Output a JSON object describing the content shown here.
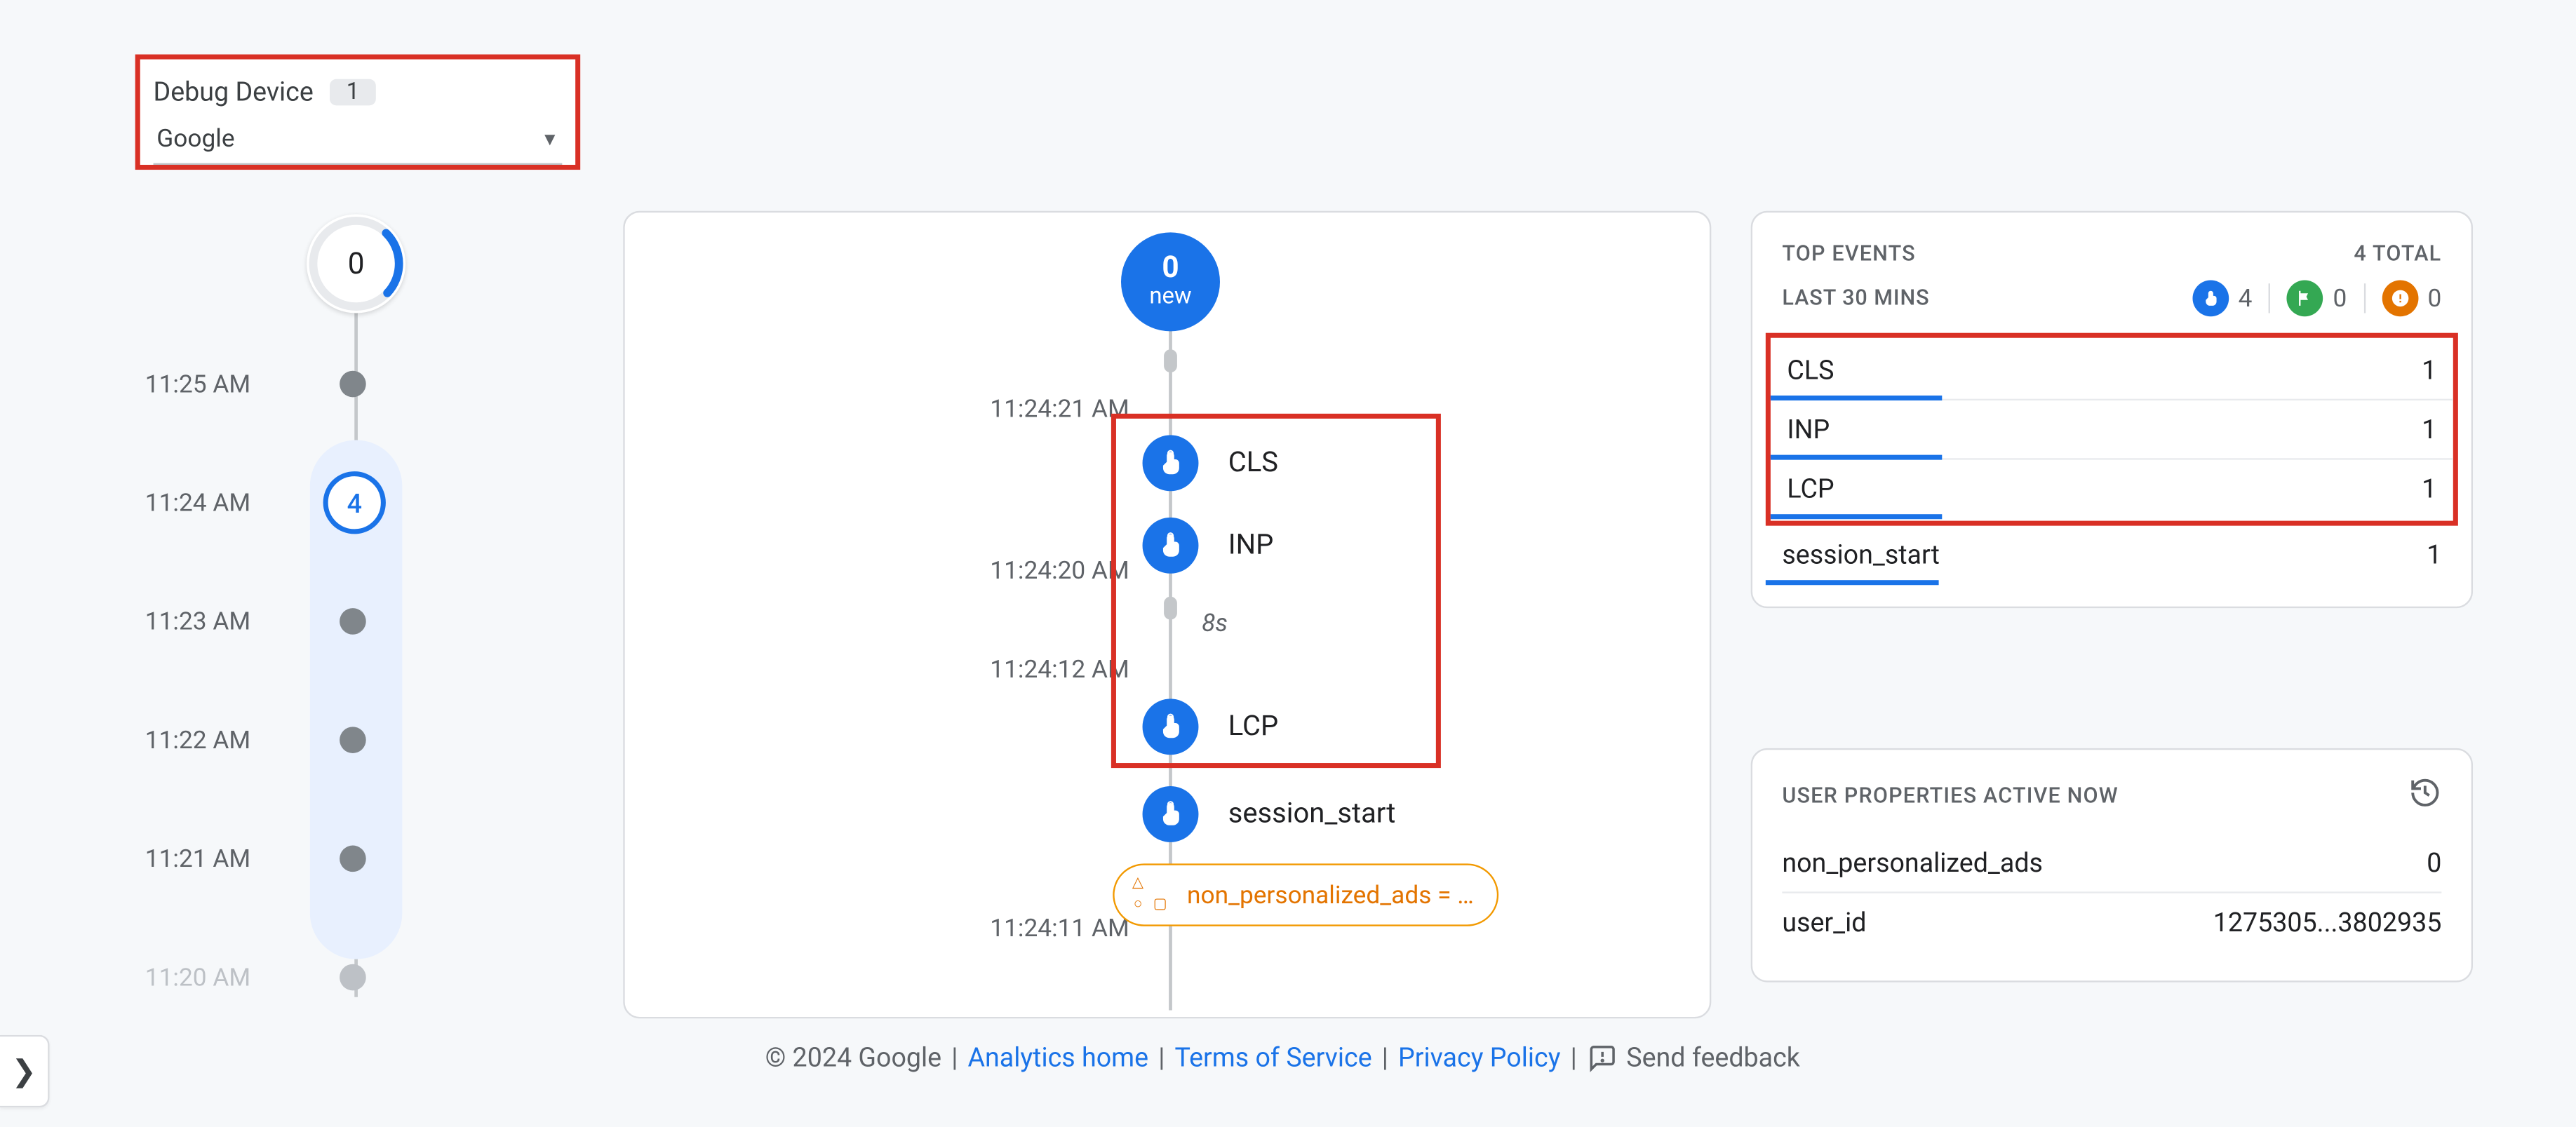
{
  "debugDevice": {
    "label": "Debug Device",
    "count": "1",
    "selected": "Google"
  },
  "minuteTimeline": {
    "spinnerValue": "0",
    "markers": [
      {
        "time": "11:25 AM",
        "type": "dot"
      },
      {
        "time": "11:24 AM",
        "type": "count",
        "count": "4"
      },
      {
        "time": "11:23 AM",
        "type": "dot"
      },
      {
        "time": "11:22 AM",
        "type": "dot"
      },
      {
        "time": "11:21 AM",
        "type": "dot"
      },
      {
        "time": "11:20 AM",
        "type": "dot",
        "faded": true
      }
    ]
  },
  "eventStream": {
    "newBubble": {
      "count": "0",
      "label": "new"
    },
    "timestamps": {
      "t1": "11:24:21 AM",
      "t2": "11:24:20 AM",
      "t3": "11:24:12 AM",
      "t4": "11:24:11 AM"
    },
    "elapsed": "8s",
    "events": {
      "cls": "CLS",
      "inp": "INP",
      "lcp": "LCP",
      "session_start": "session_start"
    },
    "propertyPill": "non_personalized_ads = …"
  },
  "topEvents": {
    "title": "TOP EVENTS",
    "totalLabel": "4 TOTAL",
    "subLabel": "LAST 30 MINS",
    "iconCounts": {
      "touch": "4",
      "flag": "0",
      "error": "0"
    },
    "rows": [
      {
        "name": "CLS",
        "count": "1",
        "barPct": 25
      },
      {
        "name": "INP",
        "count": "1",
        "barPct": 25
      },
      {
        "name": "LCP",
        "count": "1",
        "barPct": 25
      },
      {
        "name": "session_start",
        "count": "1",
        "barPct": 25
      }
    ]
  },
  "userProps": {
    "title": "USER PROPERTIES ACTIVE NOW",
    "rows": [
      {
        "name": "non_personalized_ads",
        "value": "0"
      },
      {
        "name": "user_id",
        "value": "1275305...3802935"
      }
    ]
  },
  "footer": {
    "copyright": "© 2024 Google",
    "analyticsHome": "Analytics home",
    "terms": "Terms of Service",
    "privacy": "Privacy Policy",
    "feedback": "Send feedback"
  }
}
